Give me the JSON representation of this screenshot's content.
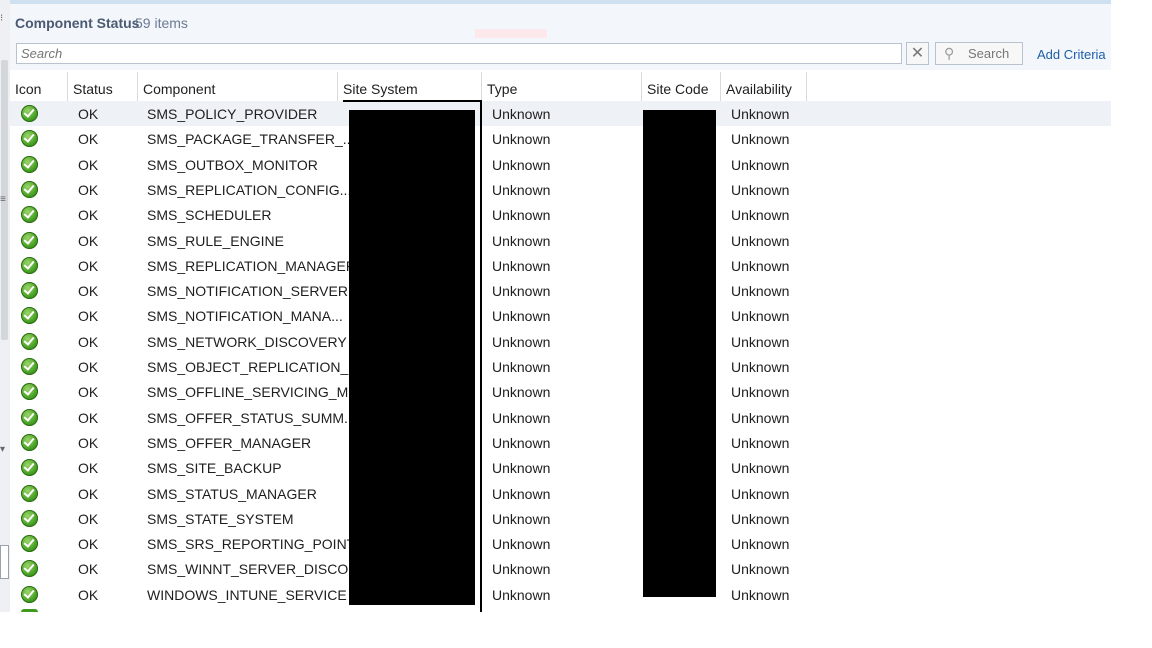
{
  "header": {
    "title": "Component Status",
    "count": "59 items"
  },
  "search": {
    "placeholder": "Search",
    "clear_glyph": "✕",
    "button_label": "Search",
    "add_criteria_label": "Add Criteria"
  },
  "columns": [
    "Icon",
    "Status",
    "Component",
    "Site System",
    "Type",
    "Site Code",
    "Availability"
  ],
  "rows": [
    {
      "status": "OK",
      "component": "SMS_POLICY_PROVIDER",
      "type": "Unknown",
      "availability": "Unknown"
    },
    {
      "status": "OK",
      "component": "SMS_PACKAGE_TRANSFER_...",
      "type": "Unknown",
      "availability": "Unknown"
    },
    {
      "status": "OK",
      "component": "SMS_OUTBOX_MONITOR",
      "type": "Unknown",
      "availability": "Unknown"
    },
    {
      "status": "OK",
      "component": "SMS_REPLICATION_CONFIG...",
      "type": "Unknown",
      "availability": "Unknown"
    },
    {
      "status": "OK",
      "component": "SMS_SCHEDULER",
      "type": "Unknown",
      "availability": "Unknown"
    },
    {
      "status": "OK",
      "component": "SMS_RULE_ENGINE",
      "type": "Unknown",
      "availability": "Unknown"
    },
    {
      "status": "OK",
      "component": "SMS_REPLICATION_MANAGER",
      "type": "Unknown",
      "availability": "Unknown"
    },
    {
      "status": "OK",
      "component": "SMS_NOTIFICATION_SERVER",
      "type": "Unknown",
      "availability": "Unknown"
    },
    {
      "status": "OK",
      "component": "SMS_NOTIFICATION_MANA...",
      "type": "Unknown",
      "availability": "Unknown"
    },
    {
      "status": "OK",
      "component": "SMS_NETWORK_DISCOVERY",
      "type": "Unknown",
      "availability": "Unknown"
    },
    {
      "status": "OK",
      "component": "SMS_OBJECT_REPLICATION_...",
      "type": "Unknown",
      "availability": "Unknown"
    },
    {
      "status": "OK",
      "component": "SMS_OFFLINE_SERVICING_M...",
      "type": "Unknown",
      "availability": "Unknown"
    },
    {
      "status": "OK",
      "component": "SMS_OFFER_STATUS_SUMM...",
      "type": "Unknown",
      "availability": "Unknown"
    },
    {
      "status": "OK",
      "component": "SMS_OFFER_MANAGER",
      "type": "Unknown",
      "availability": "Unknown"
    },
    {
      "status": "OK",
      "component": "SMS_SITE_BACKUP",
      "type": "Unknown",
      "availability": "Unknown"
    },
    {
      "status": "OK",
      "component": "SMS_STATUS_MANAGER",
      "type": "Unknown",
      "availability": "Unknown"
    },
    {
      "status": "OK",
      "component": "SMS_STATE_SYSTEM",
      "type": "Unknown",
      "availability": "Unknown"
    },
    {
      "status": "OK",
      "component": "SMS_SRS_REPORTING_POINT",
      "type": "Unknown",
      "availability": "Unknown"
    },
    {
      "status": "OK",
      "component": "SMS_WINNT_SERVER_DISCO...",
      "type": "Unknown",
      "availability": "Unknown"
    },
    {
      "status": "OK",
      "component": "WINDOWS_INTUNE_SERVICE",
      "type": "Unknown",
      "availability": "Unknown"
    }
  ],
  "colors": {
    "accent": "#1f5fa8",
    "ok_green": "#3f9a1e",
    "selected_row": "#eef1f6"
  }
}
